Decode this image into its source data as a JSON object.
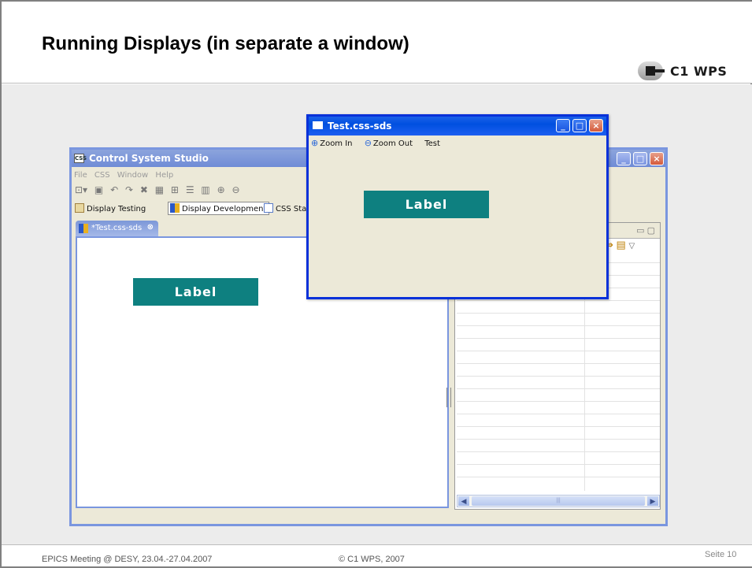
{
  "slide": {
    "title": "Running Displays (in separate a window)",
    "logo_text": "C1 WPS",
    "footer_left": "EPICS Meeting @ DESY, 23.04.-27.04.2007",
    "footer_mid": "© C1 WPS, 2007",
    "footer_right": "Seite 10"
  },
  "main_window": {
    "icon_text": "CSS",
    "title": "Control System Studio",
    "controls": [
      "_",
      "□",
      "×"
    ],
    "menu": [
      "File",
      "CSS",
      "Window",
      "Help"
    ],
    "perspectives": [
      {
        "label": "Display Testing",
        "active": false
      },
      {
        "label": "Display Development",
        "active": true
      },
      {
        "label": "CSS Stan",
        "active": false
      }
    ],
    "editor_tab": "*Test.css-sds",
    "label_widget": "Label"
  },
  "test_window": {
    "title": "Test.css-sds",
    "menu": [
      "Zoom In",
      "Zoom Out",
      "Test"
    ],
    "label_widget": "Label"
  },
  "colors": {
    "label_bg": "#0e8080",
    "xp_titlebar": "#0050e0",
    "inactive_titlebar": "#7b95e0"
  }
}
